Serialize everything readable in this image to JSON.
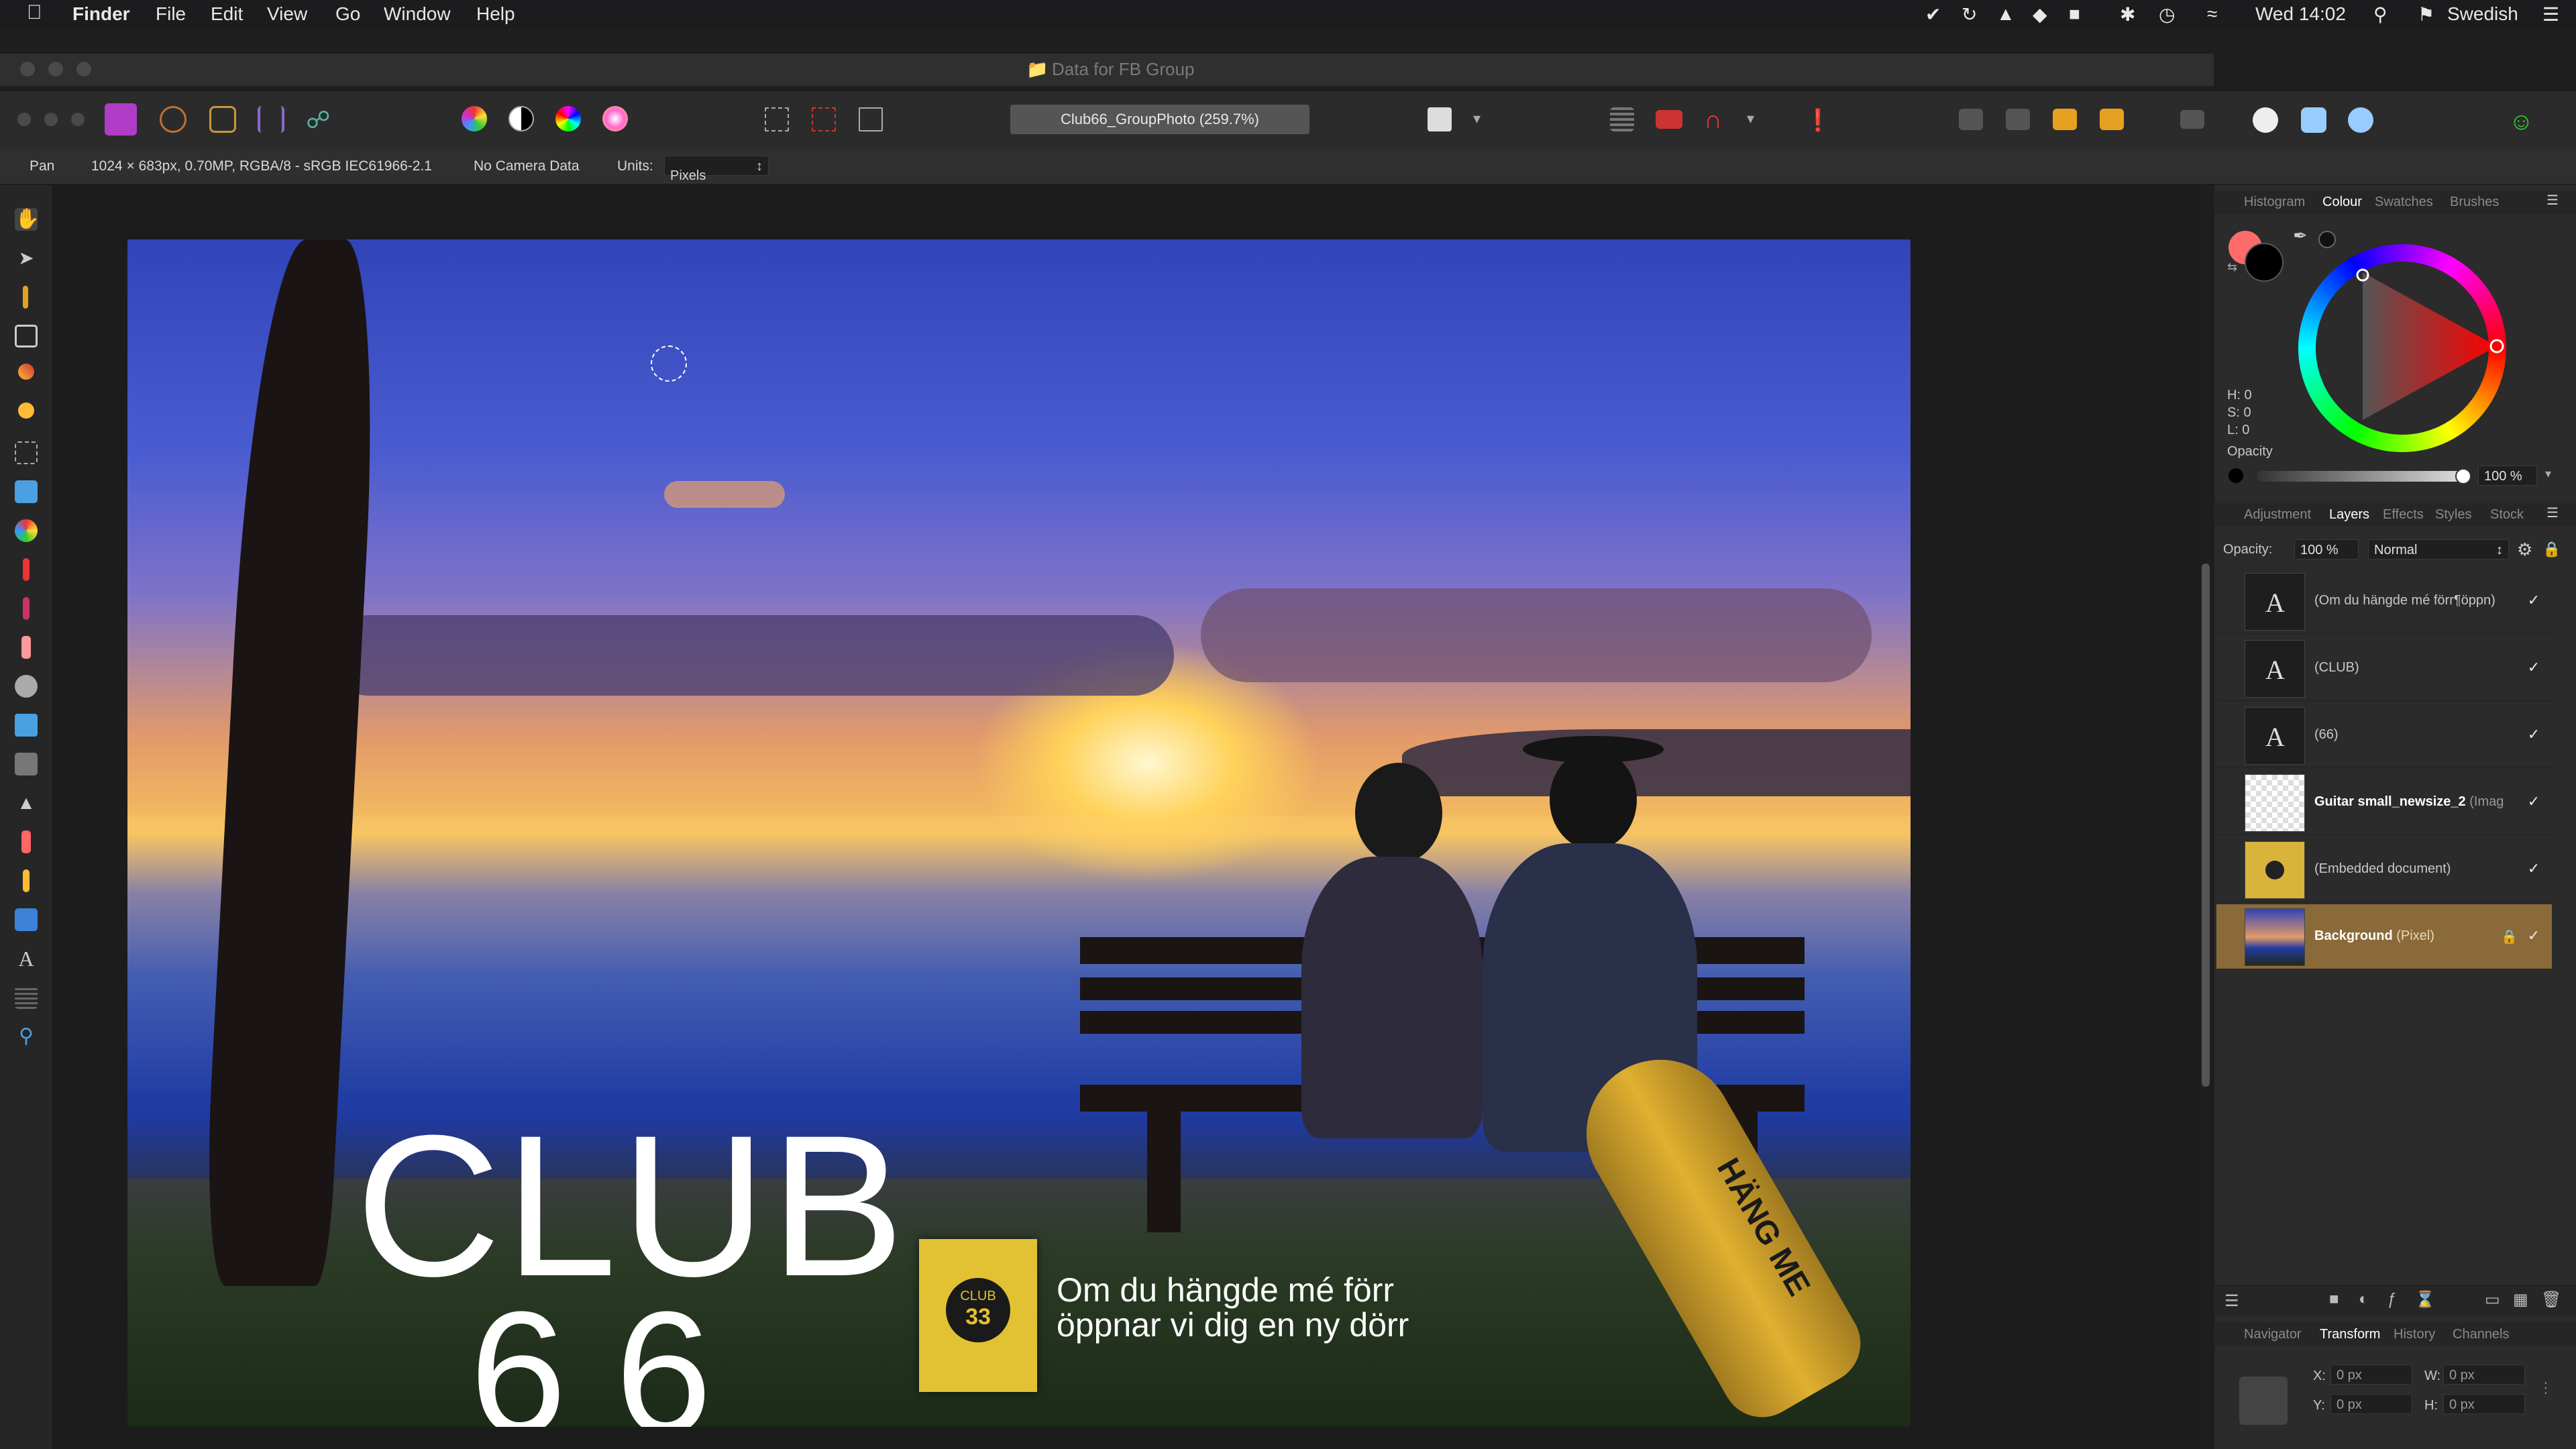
{
  "menubar": {
    "app": "Finder",
    "items": [
      "File",
      "Edit",
      "View",
      "Go",
      "Window",
      "Help"
    ],
    "clock": "Wed 14:02",
    "input_source": "Swedish"
  },
  "window": {
    "title": "Data for FB Group"
  },
  "toolbar": {
    "document_title": "Club66_GroupPhoto (259.7%)"
  },
  "context_bar": {
    "tool": "Pan",
    "doc_info": "1024 × 683px, 0.70MP, RGBA/8 - sRGB IEC61966-2.1",
    "camera": "No Camera Data",
    "units_label": "Units:",
    "units_value": "Pixels"
  },
  "photo": {
    "club_line1": "CLUB",
    "club_line2": "6 6",
    "badge_line1": "CLUB",
    "badge_line2": "33",
    "caption_line1": "Om du hängde mé förr",
    "caption_line2": "öppnar vi dig en ny dörr",
    "guitar_text": "HÄNG ME"
  },
  "colour_panel": {
    "tabs": [
      "Histogram",
      "Colour",
      "Swatches",
      "Brushes"
    ],
    "active_tab": "Colour",
    "h": "H: 0",
    "s": "S: 0",
    "l": "L: 0",
    "opacity_label": "Opacity",
    "opacity_value": "100 %"
  },
  "layers_panel": {
    "tabs": [
      "Adjustment",
      "Layers",
      "Effects",
      "Styles",
      "Stock"
    ],
    "active_tab": "Layers",
    "opacity_label": "Opacity:",
    "opacity_value": "100 %",
    "blend_mode": "Normal",
    "layers": [
      {
        "name": "(Om du hängde mé förr¶öppn)",
        "type": "text",
        "visible": true
      },
      {
        "name": "(CLUB)",
        "type": "text",
        "visible": true
      },
      {
        "name": "(66)",
        "type": "text",
        "visible": true
      },
      {
        "name": "Guitar small_newsize_2",
        "suffix": "(Imag",
        "type": "image",
        "visible": true
      },
      {
        "name": "(Embedded document)",
        "type": "embedded",
        "visible": true
      },
      {
        "name": "Background",
        "suffix": "(Pixel)",
        "type": "pixel",
        "visible": true,
        "selected": true,
        "locked": true
      }
    ],
    "checkmark": "✓",
    "text_layer_glyph": "A"
  },
  "transform_panel": {
    "tabs": [
      "Navigator",
      "Transform",
      "History",
      "Channels"
    ],
    "active_tab": "Transform",
    "x_label": "X:",
    "x_value": "0 px",
    "y_label": "Y:",
    "y_value": "0 px",
    "w_label": "W:",
    "w_value": "0 px",
    "h_label": "H:",
    "h_value": "0 px"
  },
  "colors": {
    "accent_selected_layer": "#8b6a3a",
    "primary_colour": "#ff6b6b",
    "secondary_colour": "#000000"
  }
}
